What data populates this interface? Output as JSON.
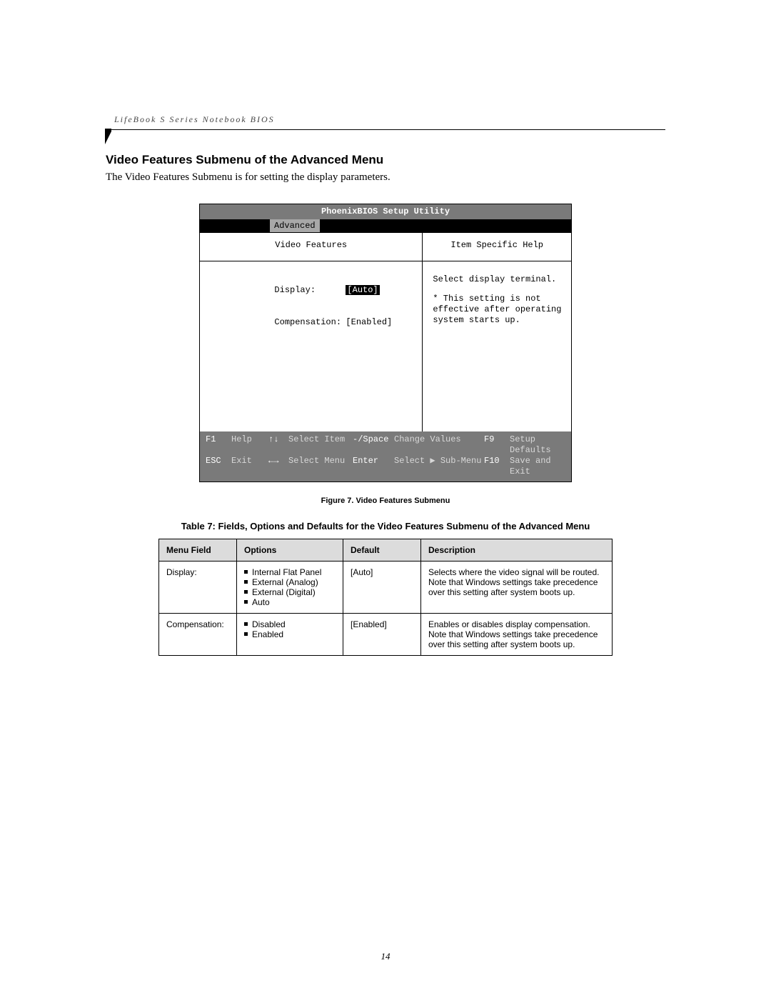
{
  "running_head": "LifeBook S Series Notebook BIOS",
  "section_title": "Video Features Submenu of the Advanced Menu",
  "intro_text": "The Video Features Submenu is for setting the display parameters.",
  "bios": {
    "title": "PhoenixBIOS Setup Utility",
    "active_menu": "Advanced",
    "left_header": "Video Features",
    "right_header": "Item Specific Help",
    "fields": {
      "display_label": "Display:",
      "display_value": "[Auto]",
      "comp_label": "Compensation:",
      "comp_value": "[Enabled]"
    },
    "help": {
      "line1": "Select display terminal.",
      "line2": "* This setting is not effective after operating system starts up."
    },
    "footer": {
      "r1": {
        "k1": "F1",
        "a1": "Help",
        "k2": "↑↓",
        "a2": "Select Item",
        "k3": "-/Space",
        "a3": "Change Values",
        "k4": "F9",
        "a4": "Setup Defaults"
      },
      "r2": {
        "k1": "ESC",
        "a1": "Exit",
        "k2": "←→",
        "a2": "Select Menu",
        "k3": "Enter",
        "a3": "Select ▶ Sub-Menu",
        "k4": "F10",
        "a4": "Save and Exit"
      }
    }
  },
  "figure_caption": "Figure 7.  Video Features Submenu",
  "table_caption": "Table 7: Fields, Options and Defaults for the Video Features Submenu of the Advanced Menu",
  "table": {
    "headers": {
      "c1": "Menu Field",
      "c2": "Options",
      "c3": "Default",
      "c4": "Description"
    },
    "rows": [
      {
        "menu_field": "Display:",
        "options": [
          "Internal Flat Panel",
          "External (Analog)",
          "External (Digital)",
          "Auto"
        ],
        "default": "[Auto]",
        "description": "Selects where the video signal will be routed. Note that Windows settings take precedence over this setting after system boots up."
      },
      {
        "menu_field": "Compensation:",
        "options": [
          "Disabled",
          "Enabled"
        ],
        "default": "[Enabled]",
        "description": "Enables or disables display compensation. Note that Windows settings take precedence over this setting after system boots up."
      }
    ]
  },
  "page_number": "14"
}
